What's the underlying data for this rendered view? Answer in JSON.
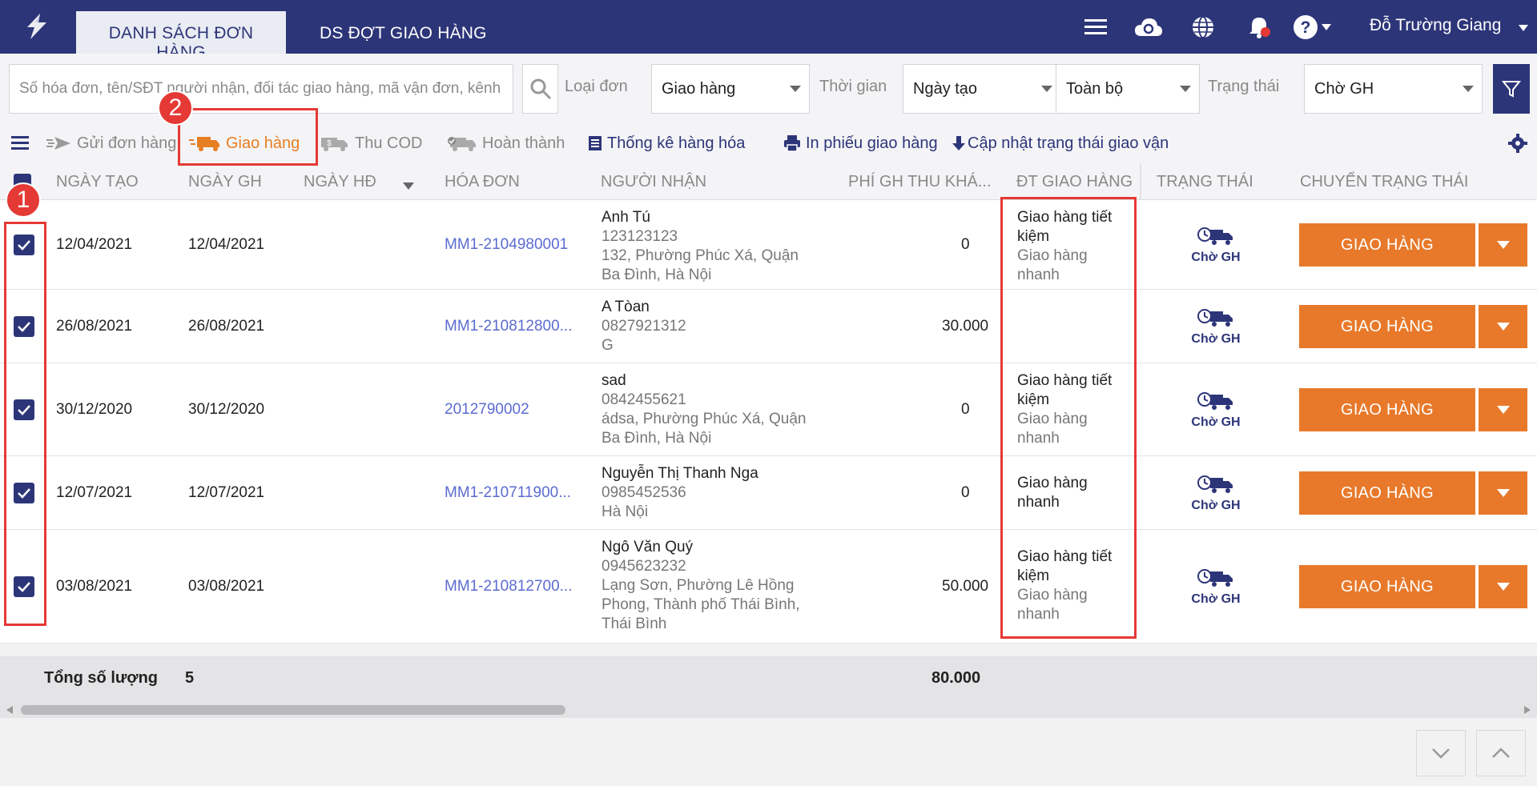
{
  "header": {
    "tabs": [
      {
        "label": "DANH SÁCH ĐƠN HÀNG",
        "active": true
      },
      {
        "label": "DS ĐỢT GIAO HÀNG",
        "active": false
      }
    ],
    "user_name": "Đỗ Trường Giang",
    "icons": [
      "menu-icon",
      "cloud-sync-icon",
      "globe-icon",
      "bell-icon",
      "help-icon"
    ]
  },
  "filters": {
    "search_placeholder": "Số hóa đơn, tên/SĐT người nhận, đối tác giao hàng, mã vận đơn, kênh",
    "order_type_label": "Loại đơn",
    "order_type_value": "Giao hàng",
    "time_label": "Thời gian",
    "time_field_value": "Ngày tạo",
    "time_range_value": "Toàn bộ",
    "status_label": "Trạng thái",
    "status_value": "Chờ GH"
  },
  "toolbar": {
    "send_order": "Gửi đơn hàng",
    "deliver": "Giao hàng",
    "collect_cod": "Thu COD",
    "complete": "Hoàn thành",
    "goods_stats": "Thống kê hàng hóa",
    "print_delivery": "In phiếu giao hàng",
    "update_shipping": "Cập nhật trạng thái giao vận"
  },
  "table": {
    "columns": {
      "created": "NGÀY TẠO",
      "delivery_date": "NGÀY GH",
      "invoice_date": "NGÀY HĐ",
      "invoice": "HÓA ĐƠN",
      "receiver": "NGƯỜI NHẬN",
      "fee": "PHÍ GH THU KHÁ...",
      "partner": "ĐT GIAO HÀNG",
      "status": "TRẠNG THÁI",
      "change_status": "CHUYỂN TRẠNG THÁI"
    },
    "rows": [
      {
        "created": "12/04/2021",
        "delivery": "12/04/2021",
        "invoice": "MM1-2104980001",
        "recv_name": "Anh Tú",
        "recv_phone": "123123123",
        "recv_addr1": "132, Phường Phúc Xá, Quận",
        "recv_addr2": "Ba Đình, Hà Nội",
        "recv_addr3": "",
        "fee": "0",
        "partner1": "Giao hàng tiết",
        "partner2": "kiệm",
        "partner3": "Giao hàng",
        "partner4": "nhanh",
        "status": "Chờ GH",
        "action": "GIAO HÀNG"
      },
      {
        "created": "26/08/2021",
        "delivery": "26/08/2021",
        "invoice": "MM1-210812800...",
        "recv_name": "A Tòan",
        "recv_phone": "0827921312",
        "recv_addr1": "G",
        "recv_addr2": "",
        "recv_addr3": "",
        "fee": "30.000",
        "partner1": "",
        "partner2": "",
        "partner3": "",
        "partner4": "",
        "status": "Chờ GH",
        "action": "GIAO HÀNG"
      },
      {
        "created": "30/12/2020",
        "delivery": "30/12/2020",
        "invoice": "2012790002",
        "recv_name": "sad",
        "recv_phone": "0842455621",
        "recv_addr1": "ádsa, Phường Phúc Xá, Quận",
        "recv_addr2": "Ba Đình, Hà Nội",
        "recv_addr3": "",
        "fee": "0",
        "partner1": "Giao hàng tiết",
        "partner2": "kiệm",
        "partner3": "Giao hàng",
        "partner4": "nhanh",
        "status": "Chờ GH",
        "action": "GIAO HÀNG"
      },
      {
        "created": "12/07/2021",
        "delivery": "12/07/2021",
        "invoice": "MM1-210711900...",
        "recv_name": "Nguyễn Thị Thanh Nga",
        "recv_phone": "0985452536",
        "recv_addr1": "Hà Nội",
        "recv_addr2": "",
        "recv_addr3": "",
        "fee": "0",
        "partner1": "Giao hàng",
        "partner2": "nhanh",
        "partner3": "",
        "partner4": "",
        "status": "Chờ GH",
        "action": "GIAO HÀNG"
      },
      {
        "created": "03/08/2021",
        "delivery": "03/08/2021",
        "invoice": "MM1-210812700...",
        "recv_name": "Ngô Văn Quý",
        "recv_phone": "0945623232",
        "recv_addr1": "Lạng Sơn, Phường Lê Hồng",
        "recv_addr2": "Phong, Thành phố Thái Bình,",
        "recv_addr3": "Thái Bình",
        "fee": "50.000",
        "partner1": "Giao hàng tiết",
        "partner2": "kiệm",
        "partner3": "Giao hàng",
        "partner4": "nhanh",
        "status": "Chờ GH",
        "action": "GIAO HÀNG"
      }
    ]
  },
  "totals": {
    "label": "Tổng số lượng",
    "count": "5",
    "fee_total": "80.000"
  },
  "annotations": {
    "badge1": "1",
    "badge2": "2"
  },
  "colors": {
    "header_bg": "#2d3579",
    "accent_orange": "#e8792a",
    "link_blue": "#5b6bd0",
    "annotation_red": "#e53935"
  }
}
